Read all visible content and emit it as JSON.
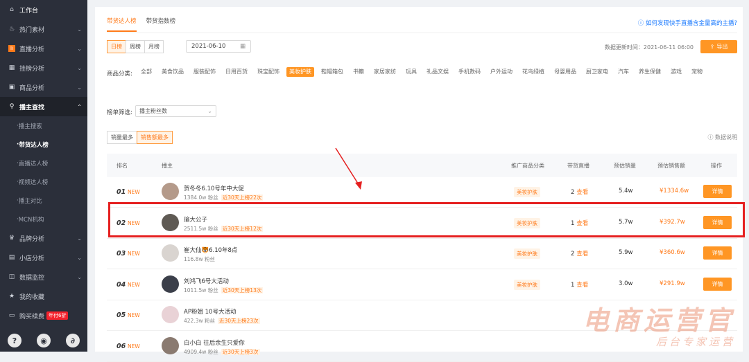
{
  "sidebar": {
    "items": [
      {
        "label": "工作台",
        "icon": "home-icon"
      },
      {
        "label": "热门素材",
        "icon": "fire-icon"
      },
      {
        "label": "直播分析",
        "icon": "live-icon"
      },
      {
        "label": "挂榜分析",
        "icon": "chart-icon"
      },
      {
        "label": "商品分析",
        "icon": "shop-icon"
      },
      {
        "label": "播主查找",
        "icon": "search-icon"
      }
    ],
    "subitems": [
      "播主搜索",
      "带货达人榜",
      "直播达人榜",
      "视频达人榜",
      "播主对比",
      "MCN机构"
    ],
    "items2": [
      {
        "label": "品牌分析",
        "icon": "brand-icon"
      },
      {
        "label": "小店分析",
        "icon": "store-icon"
      },
      {
        "label": "数据监控",
        "icon": "monitor-icon"
      },
      {
        "label": "我的收藏",
        "icon": "star-icon"
      },
      {
        "label": "购买续费",
        "icon": "card-icon",
        "badge": "年付6折"
      }
    ],
    "bottom_icons": [
      "help-icon",
      "wechat-icon",
      "share-icon"
    ]
  },
  "tabs": [
    "带货达人榜",
    "带货指数榜"
  ],
  "help_link": "如何发现快手直播含金量高的主播?",
  "period_buttons": [
    "日榜",
    "周榜",
    "月榜"
  ],
  "date": "2021-06-10",
  "update_time": "数据更新时间：2021-06-11 06:00",
  "export_label": "导出",
  "category_label": "商品分类:",
  "categories": [
    "全部",
    "美食饮品",
    "服装配饰",
    "日用百货",
    "珠宝配饰",
    "美妆护肤",
    "鞋帽箱包",
    "书籍",
    "家居家纺",
    "玩具",
    "礼品文娱",
    "手机数码",
    "户外运动",
    "花鸟绿植",
    "母婴用品",
    "厨卫家电",
    "汽车",
    "养生保健",
    "游戏",
    "宠物"
  ],
  "active_category": "美妆护肤",
  "filter_label": "榜单筛选:",
  "filter_value": "播主粉丝数",
  "sort_buttons": [
    "销量最多",
    "销售额最多"
  ],
  "data_desc": "数据说明",
  "columns": [
    "排名",
    "播主",
    "推广商品分类",
    "带货直播",
    "预估销量",
    "预估销售额",
    "操作"
  ],
  "rows": [
    {
      "rank": "01",
      "new": "NEW",
      "name": "贺冬冬6.10号年中大促",
      "fans": "1384.0w 粉丝",
      "hot": "近30天上榜22次",
      "category": "美妆护肤",
      "live": "2",
      "live_link": "查看",
      "sales": "5.4w",
      "amount": "¥1334.6w",
      "action": "详情"
    },
    {
      "rank": "02",
      "new": "NEW",
      "name": "瑜大公子",
      "fans": "2511.5w 粉丝",
      "hot": "近30天上榜12次",
      "category": "美妆护肤",
      "live": "1",
      "live_link": "查看",
      "sales": "5.7w",
      "amount": "¥392.7w",
      "action": "详情"
    },
    {
      "rank": "03",
      "new": "NEW",
      "name": "崔大仙🐯6.10年8点",
      "fans": "116.8w 粉丝",
      "hot": "",
      "category": "美妆护肤",
      "live": "2",
      "live_link": "查看",
      "sales": "5.9w",
      "amount": "¥360.6w",
      "action": "详情"
    },
    {
      "rank": "04",
      "new": "NEW",
      "name": "刘鸿飞6号大活动",
      "fans": "1011.5w 粉丝",
      "hot": "近30天上榜13次",
      "category": "美妆护肤",
      "live": "1",
      "live_link": "查看",
      "sales": "3.0w",
      "amount": "¥291.9w",
      "action": "详情"
    },
    {
      "rank": "05",
      "new": "NEW",
      "name": "AP粉姐 10号大活动",
      "fans": "422.3w 粉丝",
      "hot": "近30天上榜23次",
      "category": "",
      "live": "",
      "live_link": "",
      "sales": "",
      "amount": "",
      "action": ""
    },
    {
      "rank": "06",
      "new": "NEW",
      "name": "白小白 往后余生只爱你",
      "fans": "4909.4w 粉丝",
      "hot": "近30天上榜3次",
      "category": "",
      "live": "",
      "live_link": "",
      "sales": "",
      "amount": "",
      "action": ""
    }
  ],
  "watermark": {
    "line1": "电商运营官",
    "line2": "后台专家运营"
  }
}
